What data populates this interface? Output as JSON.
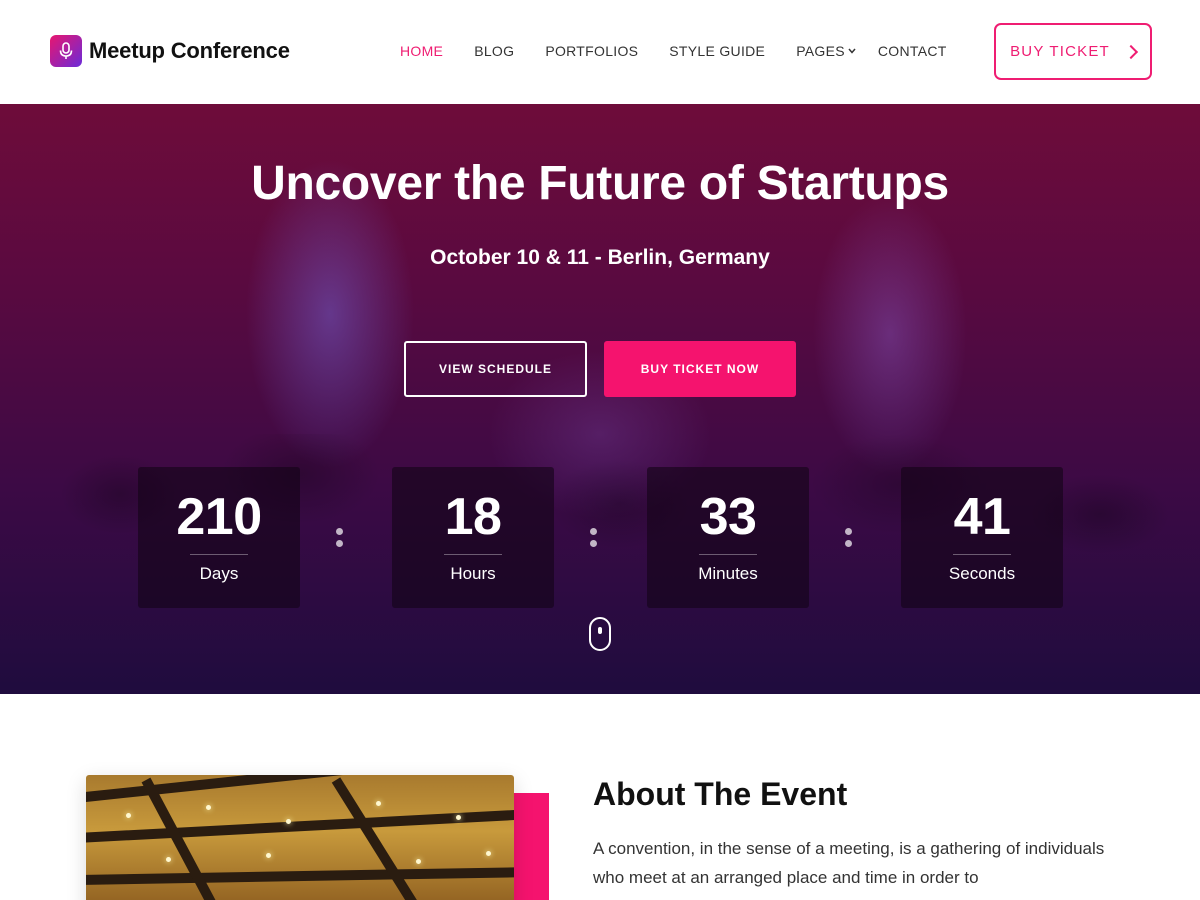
{
  "brand": {
    "name": "Meetup Conference",
    "logo_icon": "microphone-icon",
    "accent": "#ef1d72"
  },
  "nav": {
    "items": [
      {
        "label": "HOME",
        "active": true
      },
      {
        "label": "BLOG"
      },
      {
        "label": "PORTFOLIOS"
      },
      {
        "label": "STYLE GUIDE"
      },
      {
        "label": "PAGES",
        "dropdown": true
      },
      {
        "label": "CONTACT"
      }
    ],
    "cta": "BUY TICKET"
  },
  "hero": {
    "title": "Uncover the Future of Startups",
    "subtitle": "October 10 & 11 - Berlin, Germany",
    "btn_schedule": "VIEW SCHEDULE",
    "btn_ticket": "BUY TICKET NOW",
    "countdown": [
      {
        "value": "210",
        "label": "Days"
      },
      {
        "value": "18",
        "label": "Hours"
      },
      {
        "value": "33",
        "label": "Minutes"
      },
      {
        "value": "41",
        "label": "Seconds"
      }
    ]
  },
  "about": {
    "title": "About The Event",
    "text": "A convention, in the sense of a meeting, is a gathering of individuals who meet at an arranged place and time in order to"
  }
}
